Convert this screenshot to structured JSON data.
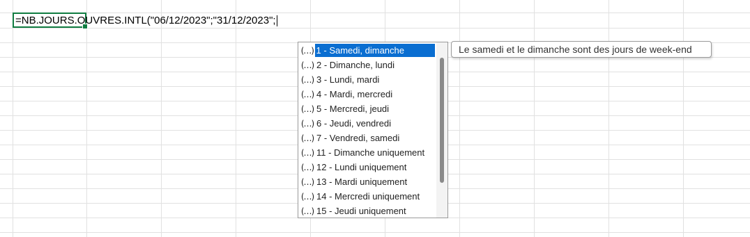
{
  "cell": {
    "formula": "=NB.JOURS.OUVRES.INTL(\"06/12/2023\";\"31/12/2023\";"
  },
  "autocomplete": {
    "icon_glyph": "(…)",
    "icon_name": "function-argument-icon",
    "selected_index": 0,
    "items": [
      {
        "label": "1 - Samedi, dimanche"
      },
      {
        "label": "2 - Dimanche, lundi"
      },
      {
        "label": "3 - Lundi, mardi"
      },
      {
        "label": "4 - Mardi, mercredi"
      },
      {
        "label": "5 - Mercredi, jeudi"
      },
      {
        "label": "6 - Jeudi, vendredi"
      },
      {
        "label": "7 - Vendredi, samedi"
      },
      {
        "label": "11 - Dimanche uniquement"
      },
      {
        "label": "12 - Lundi uniquement"
      },
      {
        "label": "13 - Mardi uniquement"
      },
      {
        "label": "14 - Mercredi uniquement"
      },
      {
        "label": "15 - Jeudi uniquement"
      }
    ]
  },
  "tooltip": {
    "text": "Le samedi et le dimanche sont des jours de week-end"
  },
  "colors": {
    "selection": "#0a6ed1",
    "active_cell_border": "#107c41",
    "gridline": "#e1e1e1"
  }
}
